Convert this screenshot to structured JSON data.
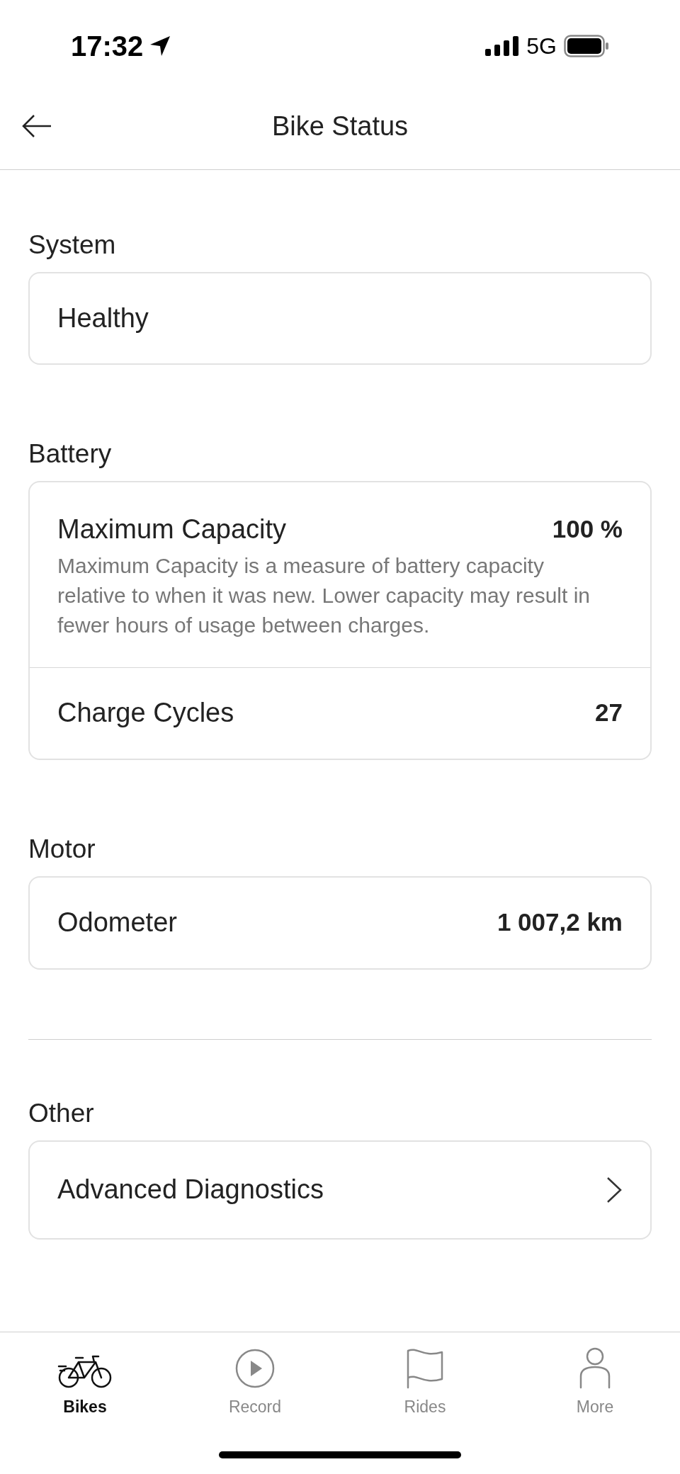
{
  "status_bar": {
    "time": "17:32",
    "network": "5G"
  },
  "header": {
    "title": "Bike Status"
  },
  "sections": [
    {
      "title": "System",
      "divider_before": false,
      "rows": [
        {
          "kind": "text",
          "label": "Healthy"
        }
      ]
    },
    {
      "title": "Battery",
      "divider_before": false,
      "rows": [
        {
          "kind": "detail",
          "label": "Maximum Capacity",
          "value": "100 %",
          "description": "Maximum Capacity is a measure of battery capacity relative to when it was new. Lower capacity may result in fewer hours of usage between charges."
        },
        {
          "kind": "value",
          "label": "Charge Cycles",
          "value": "27"
        }
      ]
    },
    {
      "title": "Motor",
      "divider_before": false,
      "rows": [
        {
          "kind": "value",
          "label": "Odometer",
          "value": "1 007,2 km"
        }
      ]
    },
    {
      "title": "Other",
      "divider_before": true,
      "rows": [
        {
          "kind": "link",
          "label": "Advanced Diagnostics"
        }
      ]
    }
  ],
  "tab_bar": [
    {
      "label": "Bikes",
      "selected": true
    },
    {
      "label": "Record",
      "selected": false
    },
    {
      "label": "Rides",
      "selected": false
    },
    {
      "label": "More",
      "selected": false
    }
  ]
}
